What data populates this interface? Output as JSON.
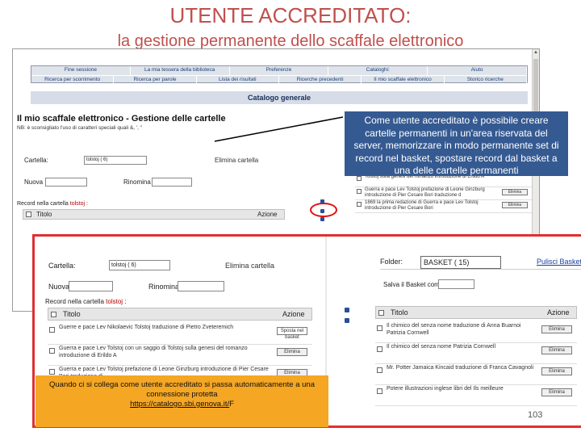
{
  "slide": {
    "title_line1": "UTENTE ACCREDITATO:",
    "title_line2": "la gestione permanente dello scaffale elettronico",
    "page_number": "103"
  },
  "nav": {
    "row1": [
      "Fine sessione",
      "La mia tessera della biblioteca",
      "Preferenze",
      "Cataloghi:",
      "Aiuto"
    ],
    "row2": [
      "Ricerca per scorrimento",
      "Ricerca per parole",
      "Lista dei risultati",
      "Ricerche precedenti",
      "Il mio scaffale elettronico",
      "Storico ricerche"
    ]
  },
  "catalog_header": "Catalogo generale",
  "back": {
    "heading": "Il mio scaffale elettronico - Gestione delle cartelle",
    "nb_text": "NB: è sconsigliato l'uso di caratteri speciali quali &, ', \"",
    "cartella_label": "Cartella:",
    "cartella_value": "tolstoj ( 6)",
    "elimina_label": "Elimina cartella",
    "nuova_label": "Nuova",
    "rinomina_label": "Rinomina",
    "record_label": "Record nella cartella",
    "record_folder": "tolstoj",
    "col_titolo": "Titolo",
    "col_azione": "Azione",
    "basket_rows": [
      {
        "text": "Tolstoj sulla genesi del romanzo introduzione di Erildo A",
        "button": ""
      },
      {
        "text": "Guerra e pace Lev Tolstoj prefazione di Leone Ginzburg introduzione di Pier Cesare Bori traduzione d",
        "button": "Elimina"
      },
      {
        "text": "1869 la prima redazione di Guerra e pace Lev Tolstoj introduzione di Pier Cesare Bori",
        "button": "Elimina"
      }
    ]
  },
  "callout_text": "Come utente accreditato è possibile creare cartelle permanenti in un'area riservata del server, memorizzare in modo permanente set di record nel basket, spostare record dal basket a una delle cartelle permanenti",
  "front": {
    "cartella_label": "Cartella:",
    "cartella_value": "tolstoj ( 6)",
    "elimina_label": "Elimina cartella",
    "nuova_label": "Nuova",
    "rinomina_label": "Rinomina",
    "record_label": "Record nella cartella",
    "record_folder": "tolstoj",
    "col_titolo": "Titolo",
    "col_azione": "Azione",
    "rows": [
      {
        "text": "Guerre e pace Lev Nikolaevic Tolstoj traduzione di Pietro Zveteremich",
        "button": "Sposta nel basket",
        "light": true
      },
      {
        "text": "Guerra e pace Lev Tolstoj con un saggio di Tolstoj sulla genesi del romanzo introduzione di Erildo A",
        "button": "Elimina",
        "light": false
      },
      {
        "text": "Guerra e pace Lev Tolstoj prefazione di Leone Ginzburg introduzione di Pier Cesare Bori traduzione di",
        "button": "Elimina",
        "light": false
      }
    ],
    "folder_label": "Folder:",
    "folder_value": "BASKET ( 15)",
    "pulisci_label": "Pulisci Basket",
    "salva_label": "Salva il Basket come",
    "basket_col_titolo": "Titolo",
    "basket_col_azione": "Azione",
    "basket_rows": [
      {
        "text": "Il chimico del senza nome traduzione di Anna Buarnoi Patrizia Cornwell",
        "button": "Elimina"
      },
      {
        "text": "Il chimico del senza nome Patrizia Cornwell",
        "button": "Elimina"
      },
      {
        "text": "Mr. Potter Jamaica Kincaid traduzione di Franca Cavagnoli",
        "button": "Elimina"
      },
      {
        "text": "Potere illustrazioni inglese libri del Ils meilleure",
        "button": "Elimina"
      }
    ]
  },
  "bottom_note": {
    "text": "Quando ci si collega come utente accreditato si passa automaticamente a una connessione protetta",
    "link": "https://catalogo.sbi.genova.it/",
    "suffix": "F"
  },
  "colors": {
    "title": "#c0504d",
    "callout_bg": "#355a92",
    "note_bg": "#f5a623",
    "highlight_red": "#e0302f"
  }
}
